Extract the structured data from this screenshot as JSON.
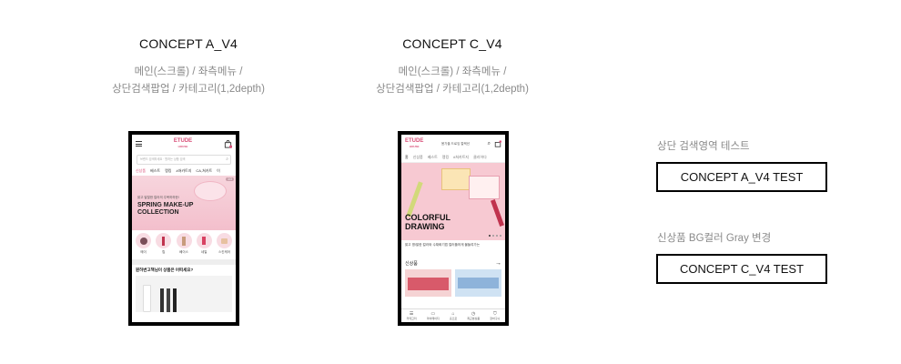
{
  "concept_a": {
    "title": "CONCEPT A_V4",
    "sub_line1": "메인(스크롤) / 좌측메뉴 /",
    "sub_line2": "상단검색팝업 / 카테고리(1,2depth)",
    "phone": {
      "logo": "ETUDE",
      "logo_sub": "HOUSE",
      "search_placeholder": "브랜드 검색하세요 · 원하는 상품 검색",
      "tabs": [
        "신상품",
        "베스트",
        "랭킹",
        "#쳐카트지",
        "CA,쳐카트",
        "이"
      ],
      "banner_small": "밝고 발랄한 컬러의 주목하하한!",
      "banner_title_1": "SPRING MAKE-UP",
      "banner_title_2": "COLLECTION",
      "banner_counter": "1/3",
      "categories": [
        "메이",
        "립",
        "베이스",
        "네일",
        "스킨케어"
      ],
      "question": "뭔하변고책님이 상품은 어떠세요?"
    }
  },
  "concept_c": {
    "title": "CONCEPT C_V4",
    "sub_line1": "메인(스크롤) / 좌측메뉴 /",
    "sub_line2": "상단검색팝업 / 카테고리(1,2depth)",
    "phone": {
      "logo": "ETUDE",
      "logo_sub": "HOUSE",
      "search_placeholder": "봄가을 드로잉 컬렉션",
      "tabs": [
        "홈",
        "신상품",
        "베스트",
        "랭킹",
        "#쳐카트지",
        "클리어다"
      ],
      "banner_title_1": "COLORFUL",
      "banner_title_2": "DRAWING",
      "banner_desc": "밝고 명/발한 컬러와 수채화기법 컬러플하게 물들여가는",
      "new_label": "신상품",
      "bottom_nav": [
        "카테고리",
        "마이페이지",
        "홈으로",
        "최근본상품",
        "장바구니"
      ]
    }
  },
  "right": {
    "label_1": "상단 검색영역 테스트",
    "button_1": "CONCEPT A_V4 TEST",
    "label_2": "신상품 BG컬러 Gray 변경",
    "button_2": "CONCEPT C_V4 TEST"
  },
  "colors": {
    "brand_pink": "#d94f78",
    "banner_pink": "#f6c9d3",
    "label_gray": "#8a8a8a"
  }
}
